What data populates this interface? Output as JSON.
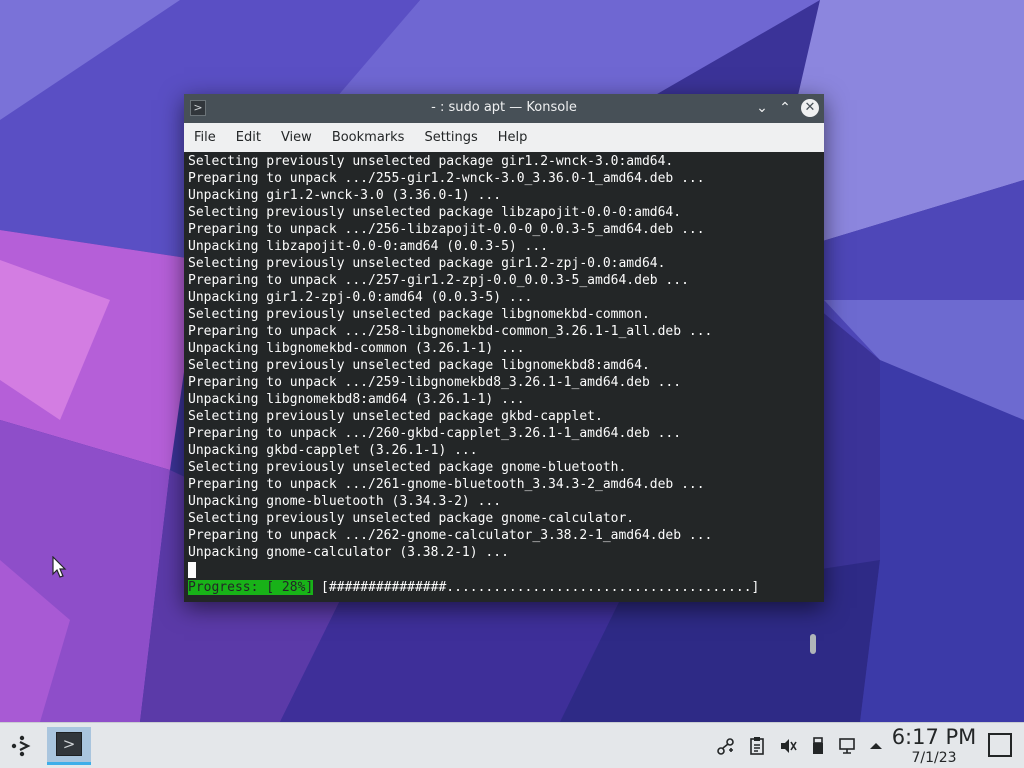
{
  "window": {
    "title": "- : sudo apt — Konsole",
    "menu": [
      "File",
      "Edit",
      "View",
      "Bookmarks",
      "Settings",
      "Help"
    ]
  },
  "terminal": {
    "lines": [
      "Selecting previously unselected package gir1.2-wnck-3.0:amd64.",
      "Preparing to unpack .../255-gir1.2-wnck-3.0_3.36.0-1_amd64.deb ...",
      "Unpacking gir1.2-wnck-3.0 (3.36.0-1) ...",
      "Selecting previously unselected package libzapojit-0.0-0:amd64.",
      "Preparing to unpack .../256-libzapojit-0.0-0_0.0.3-5_amd64.deb ...",
      "Unpacking libzapojit-0.0-0:amd64 (0.0.3-5) ...",
      "Selecting previously unselected package gir1.2-zpj-0.0:amd64.",
      "Preparing to unpack .../257-gir1.2-zpj-0.0_0.0.3-5_amd64.deb ...",
      "Unpacking gir1.2-zpj-0.0:amd64 (0.0.3-5) ...",
      "Selecting previously unselected package libgnomekbd-common.",
      "Preparing to unpack .../258-libgnomekbd-common_3.26.1-1_all.deb ...",
      "Unpacking libgnomekbd-common (3.26.1-1) ...",
      "Selecting previously unselected package libgnomekbd8:amd64.",
      "Preparing to unpack .../259-libgnomekbd8_3.26.1-1_amd64.deb ...",
      "Unpacking libgnomekbd8:amd64 (3.26.1-1) ...",
      "Selecting previously unselected package gkbd-capplet.",
      "Preparing to unpack .../260-gkbd-capplet_3.26.1-1_amd64.deb ...",
      "Unpacking gkbd-capplet (3.26.1-1) ...",
      "Selecting previously unselected package gnome-bluetooth.",
      "Preparing to unpack .../261-gnome-bluetooth_3.34.3-2_amd64.deb ...",
      "Unpacking gnome-bluetooth (3.34.3-2) ...",
      "Selecting previously unselected package gnome-calculator.",
      "Preparing to unpack .../262-gnome-calculator_3.38.2-1_amd64.deb ...",
      "Unpacking gnome-calculator (3.38.2-1) ..."
    ],
    "progress_label": "Progress: [ 28%]",
    "progress_bar": " [###############.......................................]",
    "progress_percent": 28
  },
  "panel": {
    "clock_time": "6:17 PM",
    "clock_date": "7/1/23"
  },
  "icons": {
    "launcher": "kde-app-launcher-icon",
    "task": "konsole-icon",
    "tray": [
      "network-icon",
      "clipboard-icon",
      "volume-muted-icon",
      "removable-device-icon",
      "wired-network-icon",
      "expand-tray-arrow-icon"
    ]
  },
  "colors": {
    "accent": "#3daee9",
    "progress_green": "#18b218",
    "terminal_bg": "#232627"
  }
}
